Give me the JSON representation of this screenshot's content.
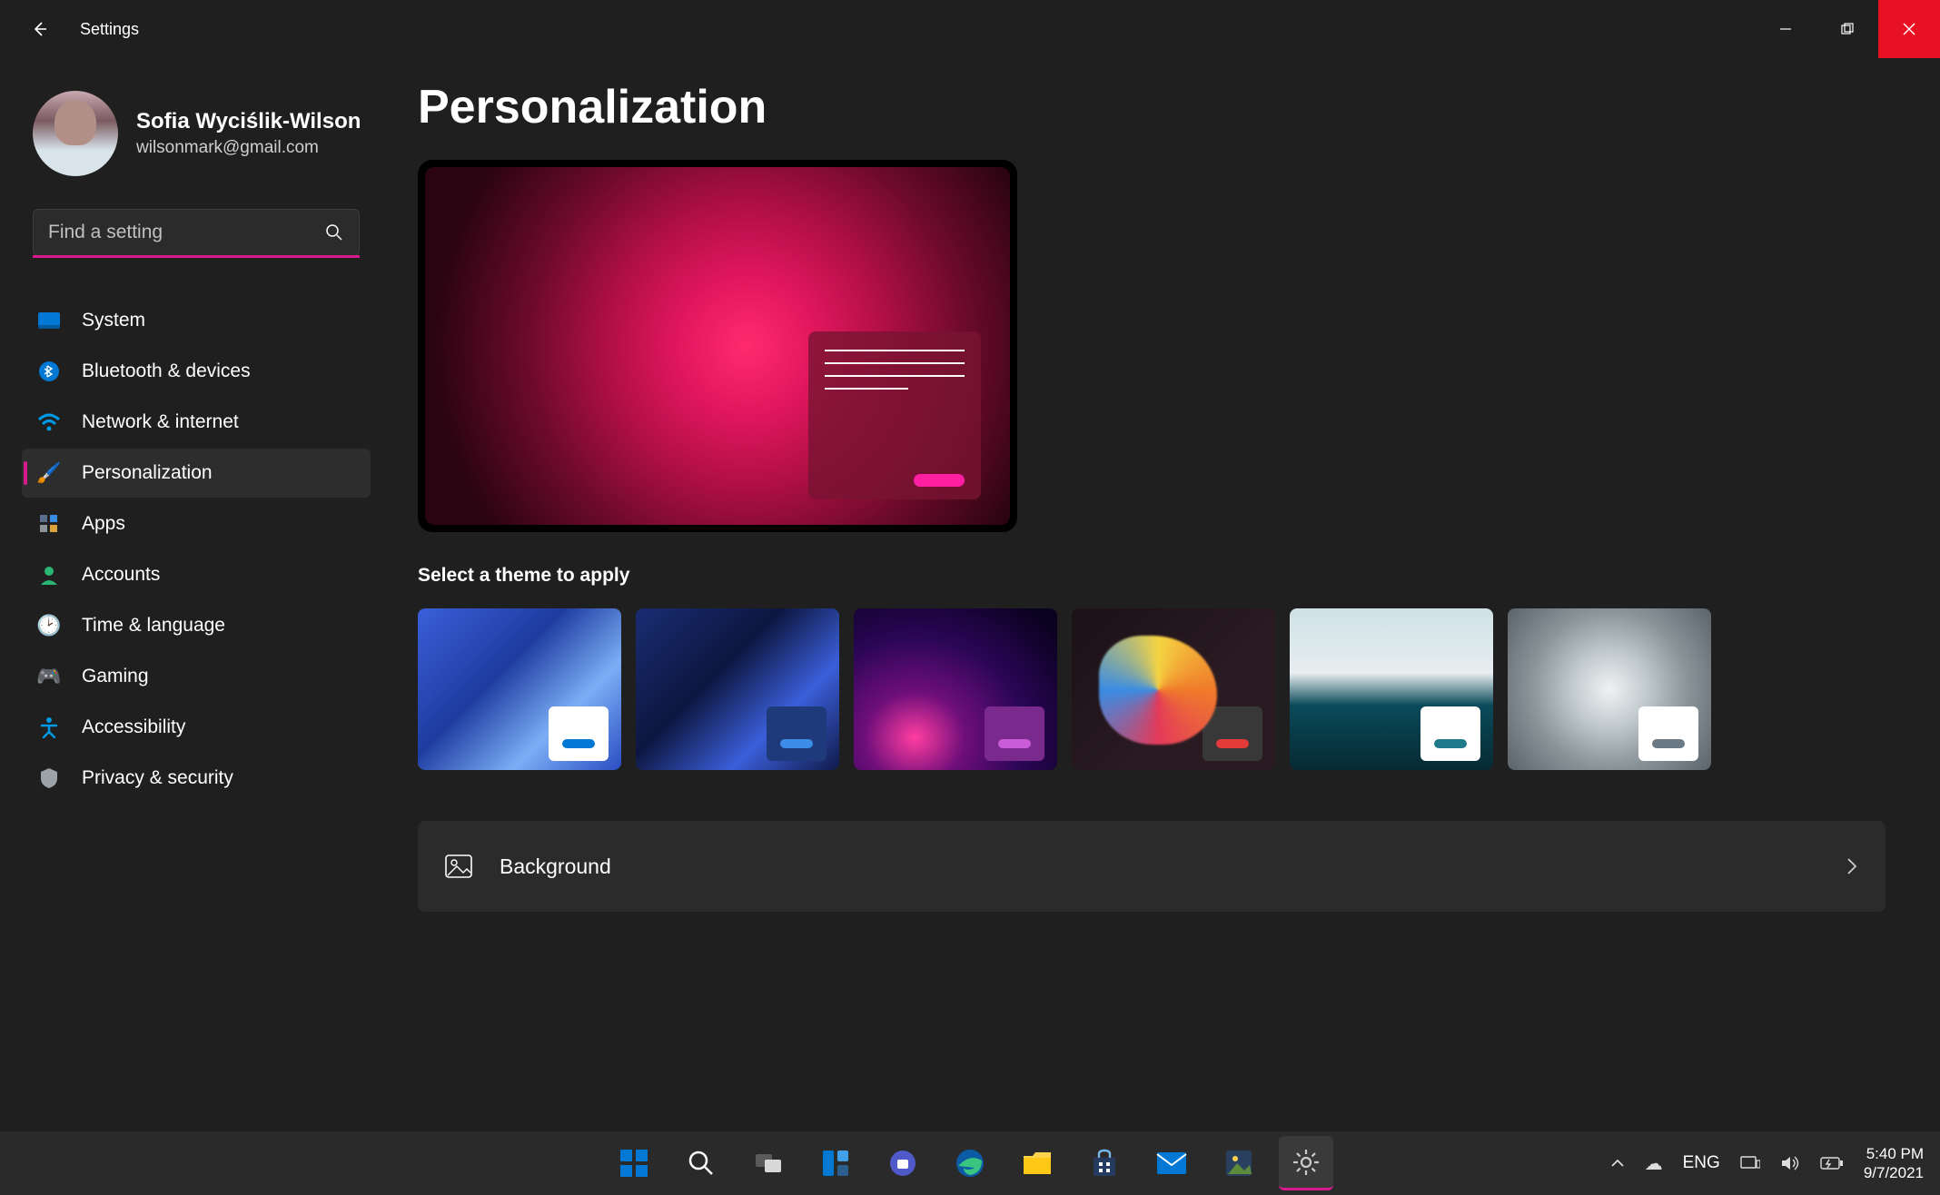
{
  "app": {
    "title": "Settings",
    "pageTitle": "Personalization"
  },
  "profile": {
    "name": "Sofia Wyciślik-Wilson",
    "email": "wilsonmark@gmail.com"
  },
  "search": {
    "placeholder": "Find a setting"
  },
  "nav": {
    "items": [
      {
        "label": "System",
        "icon": "🖥️"
      },
      {
        "label": "Bluetooth & devices",
        "icon": "bt"
      },
      {
        "label": "Network & internet",
        "icon": "wifi"
      },
      {
        "label": "Personalization",
        "icon": "🖌️",
        "active": true
      },
      {
        "label": "Apps",
        "icon": "apps"
      },
      {
        "label": "Accounts",
        "icon": "👤"
      },
      {
        "label": "Time & language",
        "icon": "🕒"
      },
      {
        "label": "Gaming",
        "icon": "🎮"
      },
      {
        "label": "Accessibility",
        "icon": "acc"
      },
      {
        "label": "Privacy & security",
        "icon": "🛡️"
      }
    ]
  },
  "themeSection": {
    "label": "Select a theme to apply"
  },
  "card": {
    "label": "Background"
  },
  "systray": {
    "lang": "ENG",
    "time": "5:40 PM",
    "date": "9/7/2021"
  },
  "taskbarApps": [
    "start",
    "search",
    "taskview",
    "widgets",
    "chat",
    "edge",
    "explorer",
    "store",
    "mail",
    "photos",
    "settings"
  ]
}
